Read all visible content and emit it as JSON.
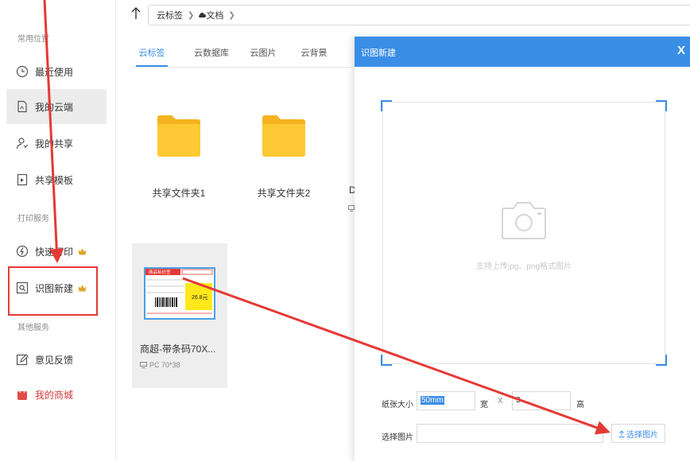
{
  "sidebar": {
    "section_common": "常用位置",
    "section_print": "打印服务",
    "section_other": "其他服务",
    "items": [
      {
        "label": "最近使用",
        "icon": "clock-icon"
      },
      {
        "label": "我的云端",
        "icon": "cloud-doc-icon"
      },
      {
        "label": "我的共享",
        "icon": "user-share-icon"
      },
      {
        "label": "共享模板",
        "icon": "template-icon"
      },
      {
        "label": "快速打印",
        "icon": "lightning-icon"
      },
      {
        "label": "识图新建",
        "icon": "scan-icon"
      },
      {
        "label": "意见反馈",
        "icon": "edit-icon"
      },
      {
        "label": "我的商城",
        "icon": "shop-bag-icon"
      }
    ]
  },
  "path": {
    "root": "云标签",
    "current": "文档"
  },
  "tabs": [
    "云标签",
    "云数据库",
    "云图片",
    "云背景"
  ],
  "active_tab": "云标签",
  "folders": [
    {
      "name": "共享文件夹1"
    },
    {
      "name": "共享文件夹2"
    }
  ],
  "partial_item": "D",
  "template": {
    "name": "商超-带条码70X...",
    "meta": "PC  70*38",
    "thumb_title": "商品标价签",
    "thumb_price": "26.8元"
  },
  "dialog": {
    "title": "识图新建",
    "close": "X",
    "upload_hint": "支持上传jpg、png格式图片",
    "paper_size_label": "纸张大小",
    "width_value": "50mm",
    "width_unit": "宽",
    "times": "X",
    "height_value": "3",
    "height_unit": "高",
    "choose_label": "选择图片",
    "choose_button": "选择图片"
  },
  "colors": {
    "accent": "#3a8ee6",
    "folder": "#f7c52e",
    "annotation": "#e53935",
    "crown": "#e0a52c"
  }
}
